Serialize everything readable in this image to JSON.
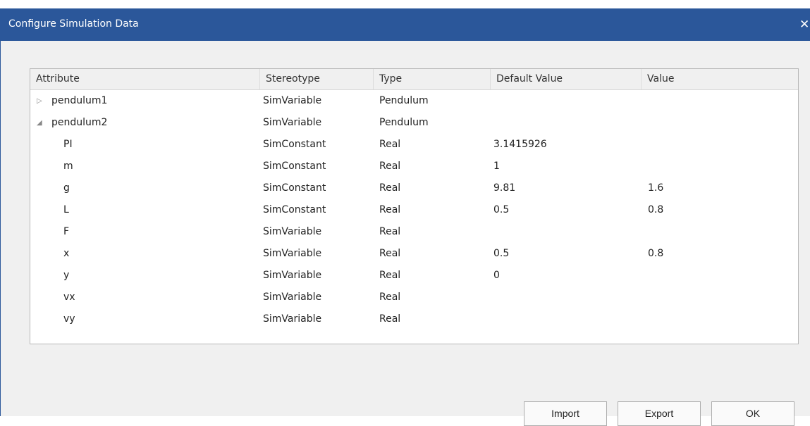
{
  "window": {
    "title": "Configure Simulation Data",
    "close_glyph": "✕",
    "accent_color": "#2b579a"
  },
  "grid": {
    "columns": [
      "Attribute",
      "Stereotype",
      "Type",
      "Default Value",
      "Value"
    ],
    "rows": [
      {
        "attribute": "pendulum1",
        "stereotype": "SimVariable",
        "type": "Pendulum",
        "default_value": "",
        "value": "",
        "expander": "▷",
        "level": 0
      },
      {
        "attribute": "pendulum2",
        "stereotype": "SimVariable",
        "type": "Pendulum",
        "default_value": "",
        "value": "",
        "expander": "◢",
        "level": 0
      },
      {
        "attribute": "PI",
        "stereotype": "SimConstant",
        "type": "Real",
        "default_value": "3.1415926",
        "value": "",
        "level": 1
      },
      {
        "attribute": "m",
        "stereotype": "SimConstant",
        "type": "Real",
        "default_value": "1",
        "value": "",
        "level": 1
      },
      {
        "attribute": "g",
        "stereotype": "SimConstant",
        "type": "Real",
        "default_value": "9.81",
        "value": "1.6",
        "level": 1
      },
      {
        "attribute": "L",
        "stereotype": "SimConstant",
        "type": "Real",
        "default_value": "0.5",
        "value": "0.8",
        "level": 1
      },
      {
        "attribute": "F",
        "stereotype": "SimVariable",
        "type": "Real",
        "default_value": "",
        "value": "",
        "level": 1
      },
      {
        "attribute": "x",
        "stereotype": "SimVariable",
        "type": "Real",
        "default_value": "0.5",
        "value": "0.8",
        "level": 1
      },
      {
        "attribute": "y",
        "stereotype": "SimVariable",
        "type": "Real",
        "default_value": "0",
        "value": "",
        "level": 1
      },
      {
        "attribute": "vx",
        "stereotype": "SimVariable",
        "type": "Real",
        "default_value": "",
        "value": "",
        "level": 1
      },
      {
        "attribute": "vy",
        "stereotype": "SimVariable",
        "type": "Real",
        "default_value": "",
        "value": "",
        "level": 1
      }
    ]
  },
  "buttons": {
    "import_label": "Import",
    "export_label": "Export",
    "ok_label": "OK"
  }
}
